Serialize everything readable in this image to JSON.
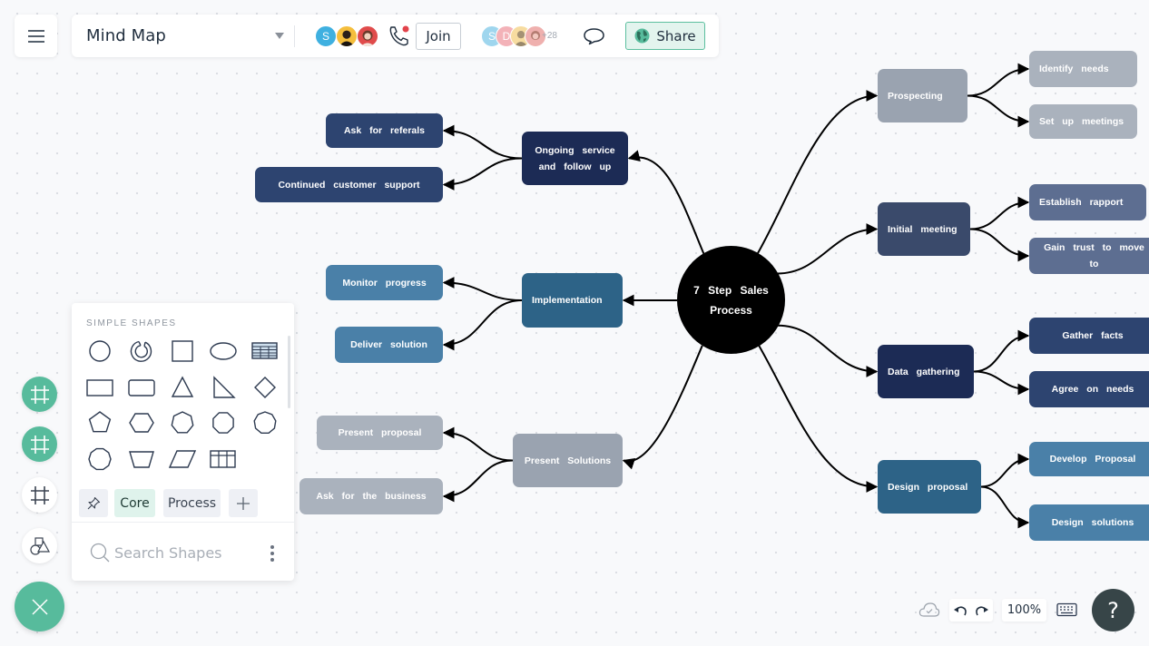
{
  "header": {
    "title": "Mind Map",
    "join_label": "Join",
    "share_label": "Share",
    "collaborators_in_call": [
      {
        "initial": "S",
        "color": "#3fb0e0"
      },
      {
        "initial": "",
        "color": "#f5be3c"
      },
      {
        "initial": "",
        "color": "#e04b4b"
      }
    ],
    "viewers": [
      {
        "initial": "S",
        "color": "#9fd6ee"
      },
      {
        "initial": "D",
        "color": "#f3b2b8"
      },
      {
        "initial": "",
        "color": "#f7dca0"
      },
      {
        "initial": "",
        "color": "#efb0ae"
      }
    ],
    "more_viewers_count": "+28",
    "accent_color": "#57bb9c"
  },
  "mindmap": {
    "center": {
      "label": "7 Step Sales Process",
      "color": "#000000"
    },
    "branches": [
      {
        "id": "ongoing",
        "label": "Ongoing service and follow up",
        "color": "#1c2b55",
        "children": [
          {
            "label": "Ask for referals",
            "color": "#2d4470"
          },
          {
            "label": "Continued customer support",
            "color": "#2d4470"
          }
        ]
      },
      {
        "id": "implementation",
        "label": "Implementation",
        "color": "#2d6387",
        "children": [
          {
            "label": "Monitor progress",
            "color": "#4a80a8"
          },
          {
            "label": "Deliver solution",
            "color": "#4a80a8"
          }
        ]
      },
      {
        "id": "present",
        "label": "Present Solutions",
        "color": "#9aa3b0",
        "children": [
          {
            "label": "Present proposal",
            "color": "#aab2bd"
          },
          {
            "label": "Ask for the business",
            "color": "#aab2bd"
          }
        ]
      },
      {
        "id": "prospecting",
        "label": "Prospecting",
        "color": "#9aa3b0",
        "children": [
          {
            "label": "Identify needs",
            "color": "#aab2bd"
          },
          {
            "label": "Set up meetings",
            "color": "#aab2bd"
          }
        ]
      },
      {
        "id": "initial",
        "label": "Initial meeting",
        "color": "#3a4a6b",
        "children": [
          {
            "label": "Establish rapport",
            "color": "#5d6e91"
          },
          {
            "label": "Gain trust to move to",
            "color": "#5d6e91"
          }
        ]
      },
      {
        "id": "data",
        "label": "Data gathering",
        "color": "#1c2b55",
        "children": [
          {
            "label": "Gather facts",
            "color": "#2d4470"
          },
          {
            "label": "Agree on needs",
            "color": "#2d4470"
          }
        ]
      },
      {
        "id": "design",
        "label": "Design proposal",
        "color": "#2d6387",
        "children": [
          {
            "label": "Develop Proposal",
            "color": "#4a80a8"
          },
          {
            "label": "Design solutions",
            "color": "#4a80a8"
          }
        ]
      }
    ]
  },
  "shapes_panel": {
    "heading": "SIMPLE SHAPES",
    "shapes": [
      "circle",
      "partial-ring",
      "square",
      "ellipse",
      "table",
      "rectangle",
      "rounded-rectangle",
      "triangle",
      "right-triangle",
      "diamond",
      "pentagon",
      "hexagon",
      "heptagon",
      "octagon",
      "nonagon",
      "decagon",
      "trapezoid",
      "parallelogram",
      "grid"
    ],
    "tabs": [
      {
        "label": "Core",
        "active": true
      },
      {
        "label": "Process",
        "active": false
      }
    ],
    "search_placeholder": "Search Shapes"
  },
  "left_tools": [
    "frame-tool-active",
    "frame-tool-active-2",
    "frame-tool",
    "shapes-tool",
    "close"
  ],
  "footer": {
    "zoom_level": "100%",
    "help_label": "?"
  }
}
